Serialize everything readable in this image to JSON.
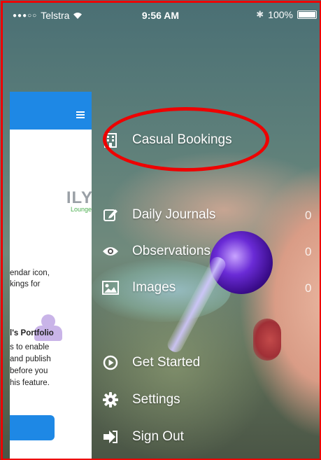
{
  "status_bar": {
    "carrier": "Telstra",
    "time": "9:56 AM",
    "battery": "100%"
  },
  "panel": {
    "logo_text": "ILY",
    "logo_sub": "Lounge",
    "text_lines": [
      "endar icon,",
      "kings for"
    ],
    "portfolio_title": "l's Portfolio",
    "portfolio_lines": [
      "s to enable",
      "and publish",
      "before you",
      "his feature."
    ]
  },
  "menu": {
    "items": [
      {
        "label": "Casual Bookings",
        "icon": "building-icon"
      },
      {
        "label": "Daily Journals",
        "icon": "edit-icon",
        "count": "0"
      },
      {
        "label": "Observations",
        "icon": "eye-icon",
        "count": "0"
      },
      {
        "label": "Images",
        "icon": "image-icon",
        "count": "0"
      },
      {
        "label": "Get Started",
        "icon": "play-circle-icon"
      },
      {
        "label": "Settings",
        "icon": "gear-icon"
      },
      {
        "label": "Sign Out",
        "icon": "sign-out-icon"
      }
    ]
  },
  "colors": {
    "annotation_red": "#e00000",
    "header_blue": "#1e88e5"
  }
}
